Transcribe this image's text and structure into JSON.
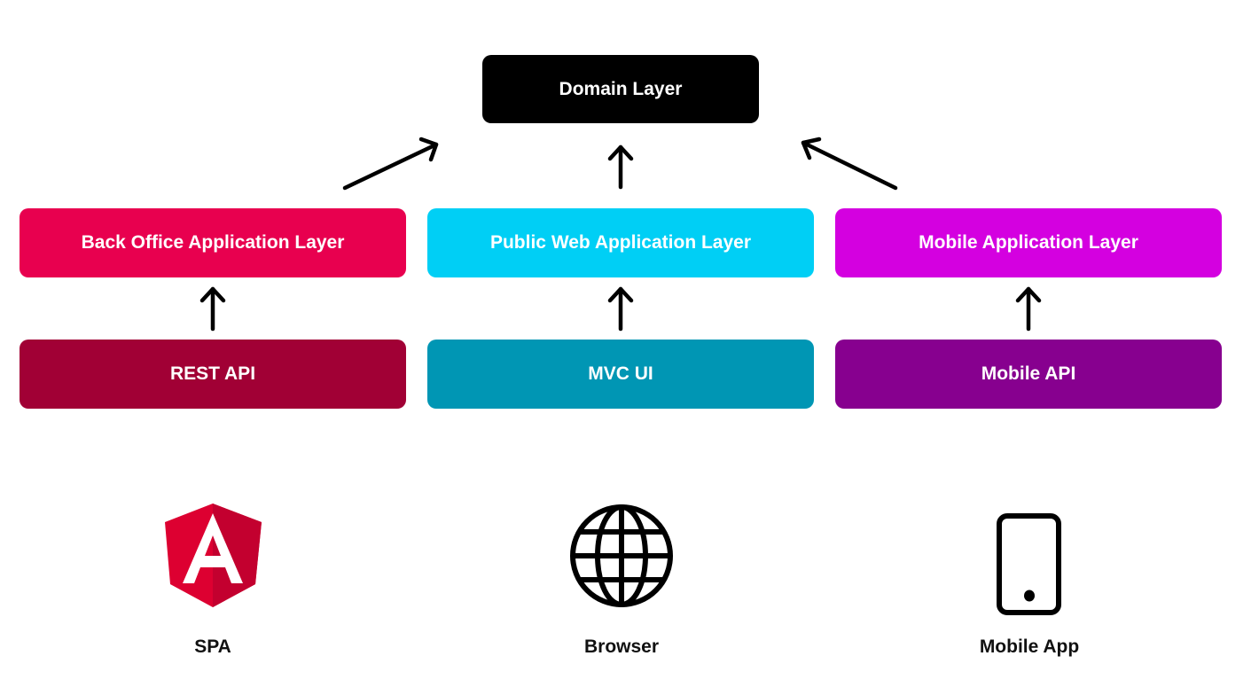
{
  "domain": {
    "label": "Domain Layer",
    "color": "#000000"
  },
  "application_layers": [
    {
      "label": "Back Office Application Layer",
      "color": "#E8004F"
    },
    {
      "label": "Public Web Application Layer",
      "color": "#00CFF5"
    },
    {
      "label": "Mobile Application Layer",
      "color": "#D400E0"
    }
  ],
  "interfaces": [
    {
      "label": "REST API",
      "color": "#A10035"
    },
    {
      "label": "MVC UI",
      "color": "#0096B4"
    },
    {
      "label": "Mobile API",
      "color": "#87008F"
    }
  ],
  "clients": [
    {
      "label": "SPA",
      "icon": "angular-logo-icon"
    },
    {
      "label": "Browser",
      "icon": "globe-icon"
    },
    {
      "label": "Mobile App",
      "icon": "smartphone-icon"
    }
  ]
}
